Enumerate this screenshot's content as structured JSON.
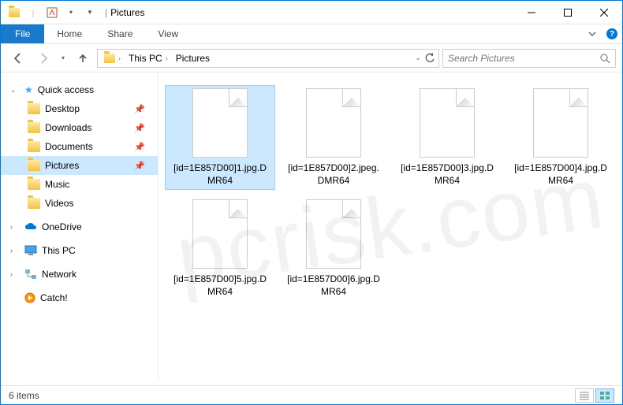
{
  "window": {
    "title": "Pictures",
    "title_prefix_sep": "|"
  },
  "ribbon": {
    "file": "File",
    "tabs": [
      "Home",
      "Share",
      "View"
    ]
  },
  "breadcrumb": {
    "items": [
      "This PC",
      "Pictures"
    ]
  },
  "search": {
    "placeholder": "Search Pictures"
  },
  "navpane": {
    "quick_access": {
      "label": "Quick access"
    },
    "quick_items": [
      {
        "label": "Desktop",
        "pinned": true
      },
      {
        "label": "Downloads",
        "pinned": true
      },
      {
        "label": "Documents",
        "pinned": true
      },
      {
        "label": "Pictures",
        "pinned": true,
        "selected": true
      },
      {
        "label": "Music",
        "pinned": false
      },
      {
        "label": "Videos",
        "pinned": false
      }
    ],
    "onedrive": "OneDrive",
    "thispc": "This PC",
    "network": "Network",
    "catch": "Catch!"
  },
  "files": [
    {
      "name": "[id=1E857D00]1.jpg.DMR64",
      "selected": true
    },
    {
      "name": "[id=1E857D00]2.jpeg.DMR64",
      "selected": false
    },
    {
      "name": "[id=1E857D00]3.jpg.DMR64",
      "selected": false
    },
    {
      "name": "[id=1E857D00]4.jpg.DMR64",
      "selected": false
    },
    {
      "name": "[id=1E857D00]5.jpg.DMR64",
      "selected": false
    },
    {
      "name": "[id=1E857D00]6.jpg.DMR64",
      "selected": false
    }
  ],
  "statusbar": {
    "count": "6 items"
  },
  "watermark": "pcrisk.com"
}
